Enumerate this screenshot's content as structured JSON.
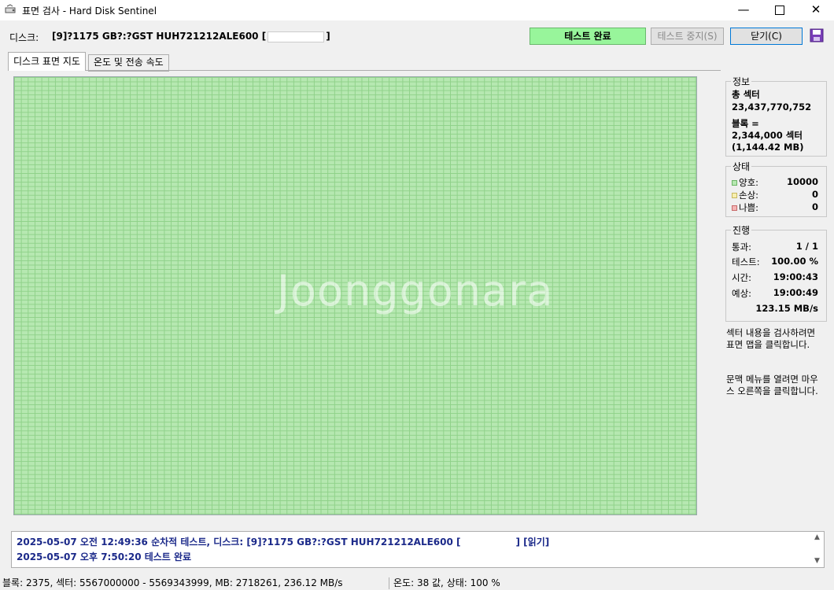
{
  "window": {
    "title": "표면 검사 - Hard Disk Sentinel",
    "minimize_glyph": "—",
    "close_glyph": "✕"
  },
  "disk": {
    "label": "디스크:",
    "value_prefix": "[9]?1175 GB?:?GST HUH721212ALE600 [",
    "value_suffix": "]"
  },
  "controls": {
    "status_label": "테스트 완료",
    "stop_label": "테스트 중지(S)",
    "close_label": "닫기(C)"
  },
  "tabs": [
    {
      "label": "디스크 표면 지도",
      "active": true
    },
    {
      "label": "온도 및 전송 속도",
      "active": false
    }
  ],
  "watermark": "Joonggonara",
  "info": {
    "title": "정보",
    "total_sectors_label": "총 섹터",
    "total_sectors_value": "23,437,770,752",
    "block_label": "블록 =",
    "block_sectors": "2,344,000 섹터",
    "block_mb": "(1,144.42 MB)"
  },
  "state": {
    "title": "상태",
    "good_label": "양호:",
    "good_value": "10000",
    "damaged_label": "손상:",
    "damaged_value": "0",
    "bad_label": "나쁨:",
    "bad_value": "0"
  },
  "progress": {
    "title": "진행",
    "pass_label": "통과:",
    "pass_value": "1 / 1",
    "test_label": "테스트:",
    "test_value": "100.00 %",
    "time_label": "시간:",
    "time_value": "19:00:43",
    "estimate_label": "예상:",
    "estimate_value": "19:00:49",
    "speed_value": "123.15 MB/s"
  },
  "help": {
    "text1": "섹터 내용을 검사하려면 표면 맵을 클릭합니다.",
    "text2": "문맥 메뉴를 열려면 마우스 오른쪽을 클릭합니다."
  },
  "log": {
    "line1_prefix": "2025-05-07  오전 12:49:36   순차적 테스트, 디스크: [9]?1175 GB?:?GST HUH721212ALE600 [",
    "line1_suffix": "] [읽기]",
    "line2": "2025-05-07  오후 7:50:20   테스트 완료"
  },
  "statusbar": {
    "left": "블록: 2375, 섹터: 5567000000 - 5569343999, MB: 2718261, 236.12 MB/s",
    "right": "온도: 38  값,  상태: 100 %"
  },
  "colors": {
    "status_ok": "#98f59b",
    "block_good": "#b6e8b1",
    "block_grid": "#8fd189",
    "log_text": "#1c2a8a"
  }
}
